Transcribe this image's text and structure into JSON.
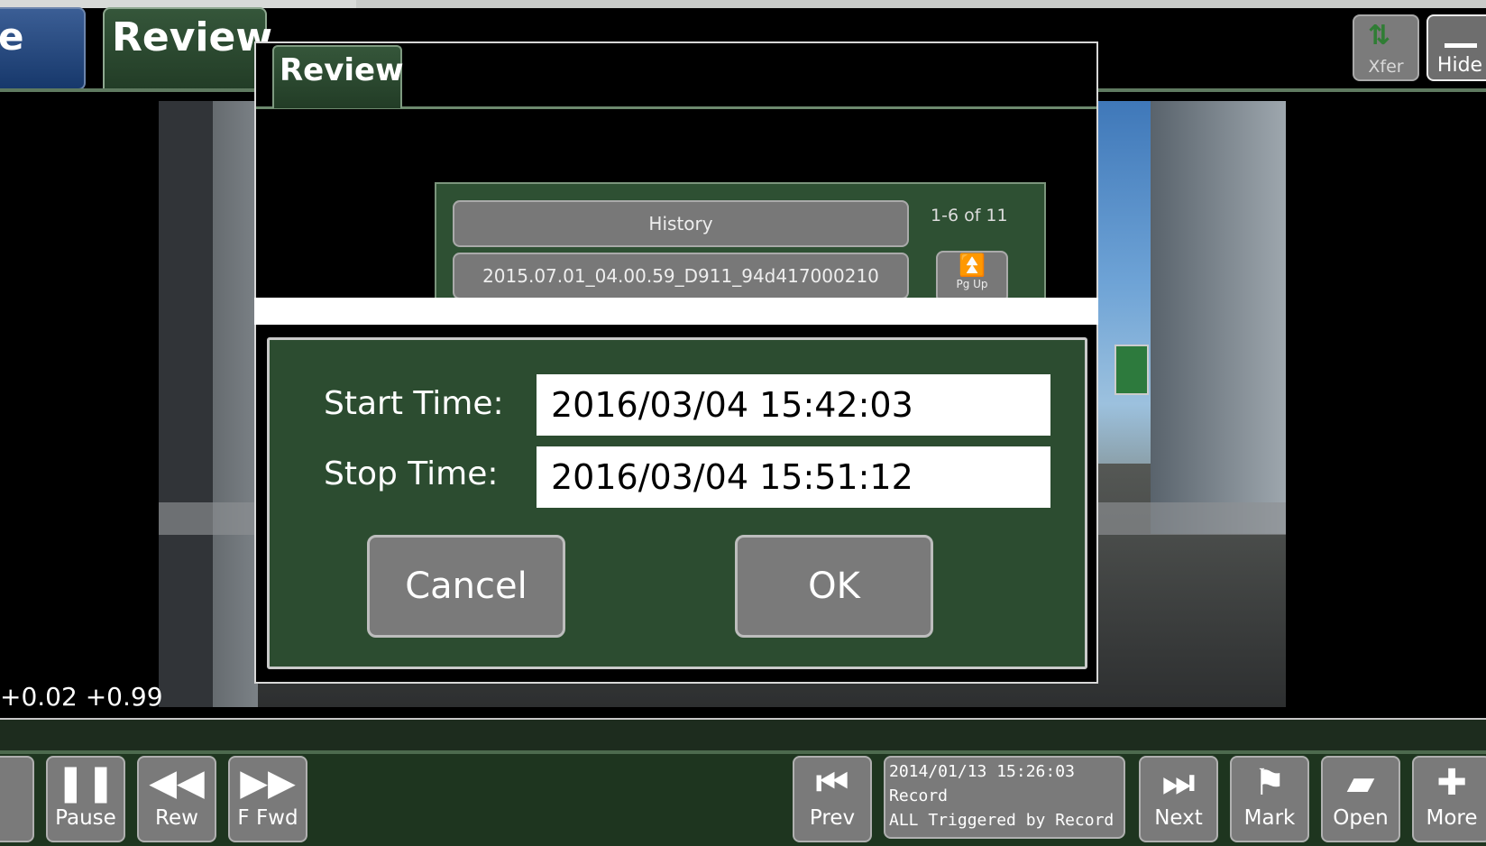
{
  "tabs": {
    "live_fragment": "e",
    "review": "Review"
  },
  "top_buttons": {
    "xfer": "Xfer",
    "hide": "Hide"
  },
  "overlay": {
    "coords": "+0.02 +0.99"
  },
  "dialog": {
    "tab": "Review",
    "history": {
      "header": "History",
      "count": "1-6 of 11",
      "first_item": "2015.07.01_04.00.59_D911_94d417000210",
      "pgup": "Pg Up"
    },
    "start_label": "Start Time:",
    "start_value": "2016/03/04 15:42:03",
    "stop_label": "Stop Time:",
    "stop_value": "2016/03/04 15:51:12",
    "cancel": "Cancel",
    "ok": "OK"
  },
  "controls": {
    "pause": "Pause",
    "rew": "Rew",
    "ffwd": "F Fwd",
    "prev": "Prev",
    "next": "Next",
    "mark": "Mark",
    "open": "Open",
    "more": "More"
  },
  "status": {
    "datetime": "2014/01/13 15:26:03",
    "mode": "Record",
    "trigger": "ALL Triggered by Record Butt"
  },
  "colors": {
    "panel_green": "#2c4c30",
    "button_gray": "#7a7a7a",
    "accent_green": "#2f7d34"
  }
}
